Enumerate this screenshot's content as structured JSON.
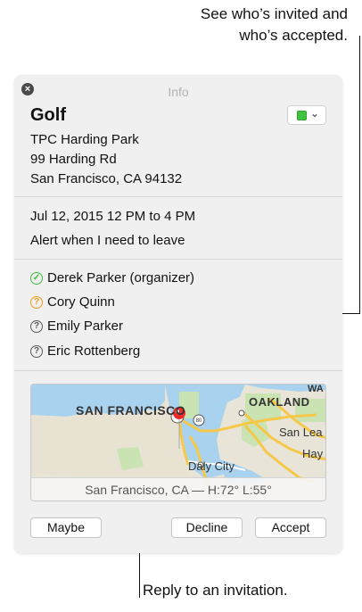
{
  "callouts": {
    "invited_line1": "See who’s invited and",
    "invited_line2": "who’s accepted.",
    "reply": "Reply to an invitation."
  },
  "window": {
    "title": "Info",
    "close_icon": "close-icon"
  },
  "event": {
    "title": "Golf",
    "calendar_color": "#3fc43f",
    "location": [
      "TPC Harding Park",
      "99 Harding Rd",
      "San Francisco, CA  94132"
    ],
    "datetime": "Jul 12, 2015  12 PM to 4 PM",
    "alert": "Alert when I need to leave"
  },
  "invitees": [
    {
      "name": "Derek Parker (organizer)",
      "status": "accepted",
      "icon": "checkmark-circle-icon"
    },
    {
      "name": "Cory Quinn",
      "status": "maybe",
      "icon": "question-circle-icon"
    },
    {
      "name": "Emily Parker",
      "status": "pending",
      "icon": "question-circle-icon"
    },
    {
      "name": "Eric Rottenberg",
      "status": "pending",
      "icon": "question-circle-icon"
    }
  ],
  "map": {
    "labels": {
      "sf": "San Francisco",
      "oakland": "Oakland",
      "san_leandro": "San Lea",
      "hayward": "Hay",
      "daly_city": "Daly City",
      "wa": "Wa",
      "shield": "80"
    },
    "caption": "San Francisco, CA — H:72° L:55°"
  },
  "buttons": {
    "maybe": "Maybe",
    "decline": "Decline",
    "accept": "Accept"
  }
}
